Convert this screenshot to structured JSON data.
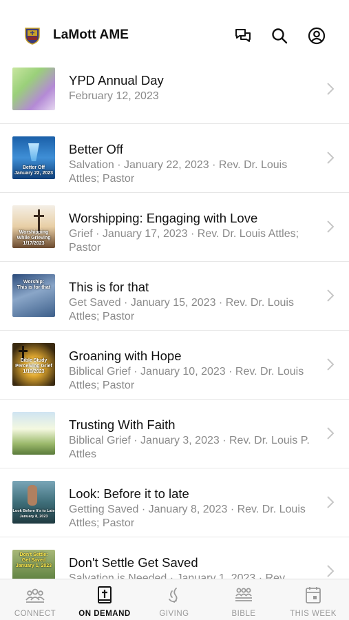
{
  "app": {
    "title": "LaMott AME"
  },
  "header": {
    "icons": [
      "chat-icon",
      "search-icon",
      "profile-icon"
    ]
  },
  "items": [
    {
      "title": "YPD Annual Day",
      "subtitle": "February 12, 2023",
      "thumb_caption": ""
    },
    {
      "title": "Better Off",
      "subtitle": "Salvation · January 22, 2023 · Rev. Dr. Louis Attles; Pastor",
      "thumb_caption": "Better Off\nJanuary 22, 2023"
    },
    {
      "title": "Worshipping: Engaging with Love",
      "subtitle": "Grief · January 17, 2023 · Rev. Dr. Louis Attles; Pastor",
      "thumb_caption": "Worshipping\nWhile Grieving\n1/17/2023"
    },
    {
      "title": "This is for that",
      "subtitle": "Get Saved · January 15, 2023 · Rev. Dr. Louis Attles; Pastor",
      "thumb_caption": "Worship:\nThis is for that"
    },
    {
      "title": "Groaning with Hope",
      "subtitle": "Biblical Grief · January 10, 2023 · Rev. Dr. Louis Attles; Pastor",
      "thumb_caption": "Bible Study\nPerceiving Grief\n1/10/2023"
    },
    {
      "title": "Trusting With Faith",
      "subtitle": "Biblical Grief · January 3, 2023 · Rev. Dr. Louis P. Attles",
      "thumb_caption": ""
    },
    {
      "title": "Look: Before it to late",
      "subtitle": "Getting Saved · January 8, 2023 · Rev. Dr. Louis Attles; Pastor",
      "thumb_caption": "Look Before It's to Late\nJanuary 8, 2023"
    },
    {
      "title": "Don't Settle Get Saved",
      "subtitle": "Salvation is Needed · January 1, 2023 · Rev.",
      "thumb_caption": "Don't Settle:\nGet Saved\nJanuary 1, 2023"
    }
  ],
  "tabs": [
    {
      "label": "CONNECT",
      "icon": "people-icon",
      "active": false
    },
    {
      "label": "ON DEMAND",
      "icon": "bible-cross-icon",
      "active": true
    },
    {
      "label": "GIVING",
      "icon": "giving-icon",
      "active": false
    },
    {
      "label": "BIBLE",
      "icon": "group-icon",
      "active": false
    },
    {
      "label": "THIS WEEK",
      "icon": "calendar-icon",
      "active": false
    }
  ]
}
